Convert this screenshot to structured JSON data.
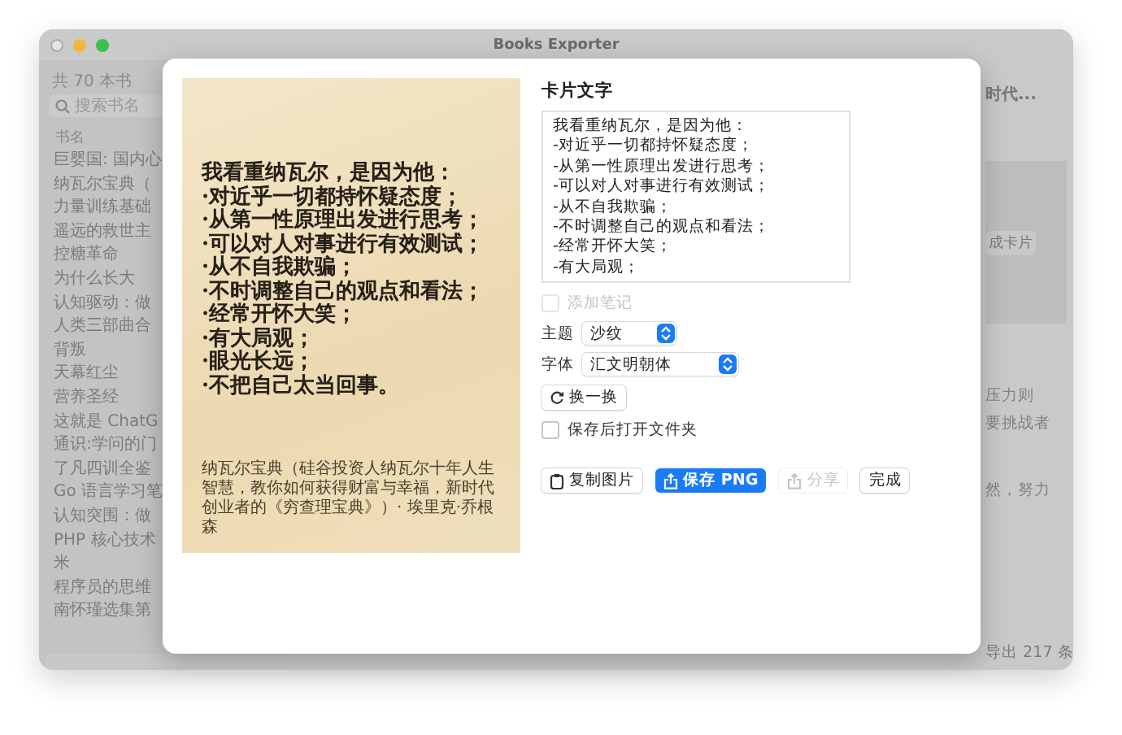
{
  "window": {
    "title": "Books Exporter"
  },
  "sidebar": {
    "count": "共 70 本书",
    "search": {
      "placeholder": "搜索书名"
    },
    "column": "书名",
    "items": [
      "巨婴国: 国内心",
      "纳瓦尔宝典（",
      "力量训练基础",
      "遥远的救世主",
      "控糖革命",
      "为什么长大",
      "认知驱动：做",
      "人类三部曲合",
      "背叛",
      "天幕红尘",
      "营养圣经",
      "这就是 ChatG",
      "通识:学问的门",
      "了凡四训全鉴",
      "Go 语言学习笔",
      "认知突围：做",
      "PHP 核心技术",
      "米",
      "程序员的思维",
      "南怀瑾选集第"
    ]
  },
  "main": {
    "title": "时代...",
    "generate_button": "成卡片",
    "snippets": [
      "压力则",
      "要挑战者",
      "然，努力"
    ],
    "status": "导出 217 条"
  },
  "dialog": {
    "card": {
      "quote_lines": [
        "我看重纳瓦尔，是因为他：",
        "·对近乎一切都持怀疑态度；",
        "·从第一性原理出发进行思考；",
        "·可以对人对事进行有效测试；",
        "·从不自我欺骗；",
        "·不时调整自己的观点和看法；",
        "·经常开怀大笑；",
        "·有大局观；",
        "·眼光长远；",
        "·不把自己太当回事。"
      ],
      "source": "纳瓦尔宝典（硅谷投资人纳瓦尔十年人生智慧，教你如何获得财富与幸福，新时代创业者的《穷查理宝典》）· 埃里克·乔根森"
    },
    "heading": "卡片文字",
    "text": "我看重纳瓦尔，是因为他：\n-对近乎一切都持怀疑态度；\n-从第一性原理出发进行思考；\n-可以对人对事进行有效测试；\n-从不自我欺骗；\n-不时调整自己的观点和看法；\n-经常开怀大笑；\n-有大局观；",
    "add_note": {
      "label": "添加笔记",
      "checked": false,
      "disabled": true
    },
    "theme": {
      "label": "主题",
      "value": "沙纹"
    },
    "font": {
      "label": "字体",
      "value": "汇文明朝体"
    },
    "shuffle_button": "换一换",
    "open_folder": {
      "label": "保存后打开文件夹",
      "checked": false
    },
    "buttons": [
      {
        "label": "复制图片",
        "kind": "copy",
        "primary": false,
        "disabled": false
      },
      {
        "label": "保存 PNG",
        "kind": "save",
        "primary": true,
        "disabled": false
      },
      {
        "label": "分享",
        "kind": "share",
        "primary": false,
        "disabled": true
      },
      {
        "label": "完成",
        "kind": "done",
        "primary": false,
        "disabled": false
      }
    ]
  }
}
